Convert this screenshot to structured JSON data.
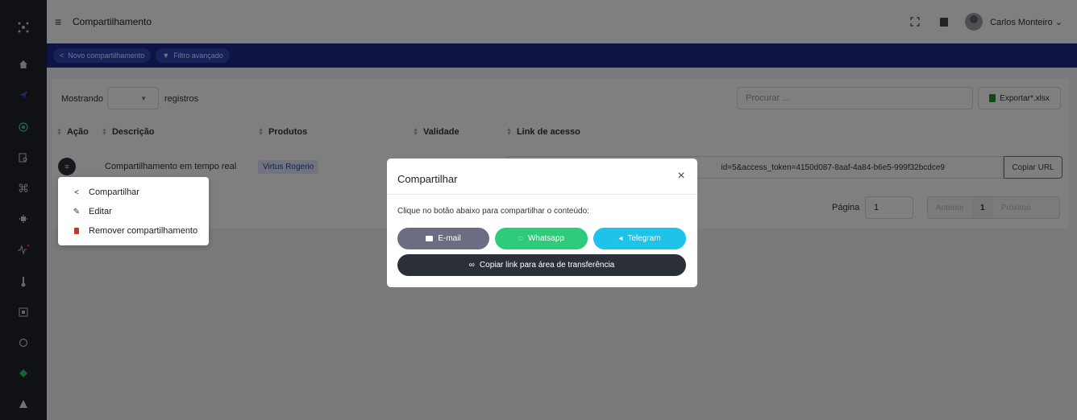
{
  "sidebar": {
    "icons": [
      "logo-icon",
      "home-icon",
      "send-icon",
      "target-icon",
      "search-doc-icon",
      "command-icon",
      "chip-icon",
      "pulse-icon",
      "thermometer-icon",
      "device-icon",
      "circle-icon",
      "diamond-icon",
      "warning-icon"
    ]
  },
  "topbar": {
    "title": "Compartilhamento",
    "user_name": "Carlos Monteiro ⌄"
  },
  "toolbar": {
    "new_share": "Novo compartilhamento",
    "advanced_filter": "Filtro avançado"
  },
  "table_controls": {
    "showing": "Mostrando",
    "records": "registros",
    "search_placeholder": "Procurar ...",
    "export": "Exportar*.xlsx"
  },
  "table": {
    "headers": [
      "Ação",
      "Descrição",
      "Produtos",
      "Validade",
      "Link de acesso"
    ],
    "rows": [
      {
        "description": "Compartilhamento em tempo real",
        "product": "Virtus Rogerio",
        "link": "id=5&access_token=4150d087-8aaf-4a84-b6e5-999f32bcdce9",
        "copy_label": "Copiar URL"
      }
    ]
  },
  "pagination": {
    "label": "Página",
    "value": "1",
    "prev": "Anterior",
    "current": "1",
    "next": "Próximo"
  },
  "dropdown": {
    "items": [
      "Compartilhar",
      "Editar",
      "Remover compartilhamento"
    ]
  },
  "modal": {
    "title": "Compartilhar",
    "text": "Clique no botão abaixo para compartilhar o conteúdo:",
    "email": "E-mail",
    "whatsapp": "Whatsapp",
    "telegram": "Telegram",
    "copy_link": "Copiar link para área de transferência"
  },
  "colors": {
    "sidebar": "#1e2229",
    "toolbar": "#1c2a8a",
    "whatsapp": "#2ecc7a",
    "telegram": "#1ec3e9",
    "email": "#6b6d82"
  }
}
